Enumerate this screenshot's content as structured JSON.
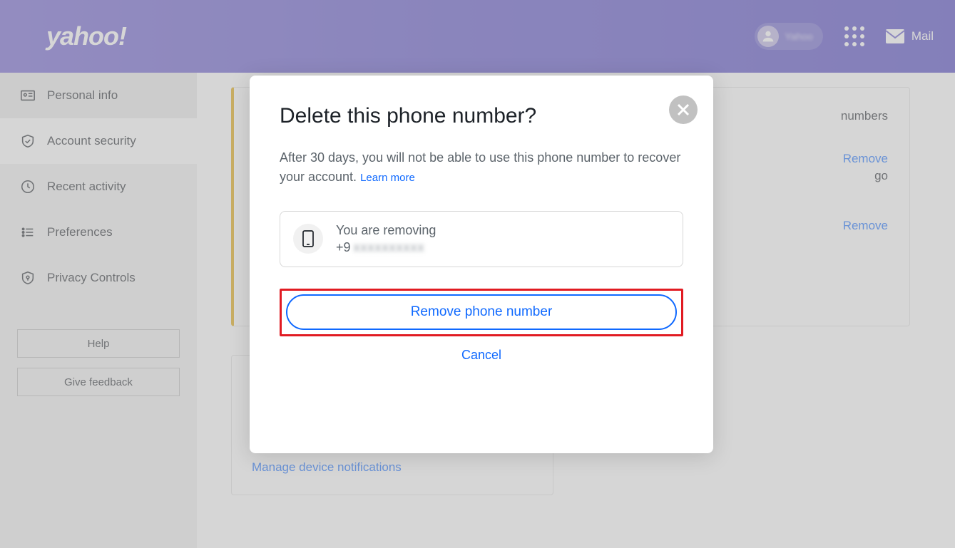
{
  "header": {
    "logo": "yahoo!",
    "username": "Yahoo",
    "mail_label": "Mail"
  },
  "sidebar": {
    "items": [
      {
        "label": "Personal info"
      },
      {
        "label": "Account security"
      },
      {
        "label": "Recent activity"
      },
      {
        "label": "Preferences"
      },
      {
        "label": "Privacy Controls"
      }
    ],
    "help_label": "Help",
    "feedback_label": "Give feedback"
  },
  "content": {
    "top_heading_fragment": "numbers",
    "time_fragment": "go",
    "remove_label": "Remove",
    "manage_link": "Manage device notifications"
  },
  "modal": {
    "title": "Delete this phone number?",
    "description": "After 30 days, you will not be able to use this phone number to recover your account.",
    "learn_more": "Learn more",
    "removing_label": "You are removing",
    "phone_prefix": "+9",
    "phone_obscured": "xxxxxxxxxx",
    "remove_button": "Remove phone number",
    "cancel": "Cancel"
  }
}
